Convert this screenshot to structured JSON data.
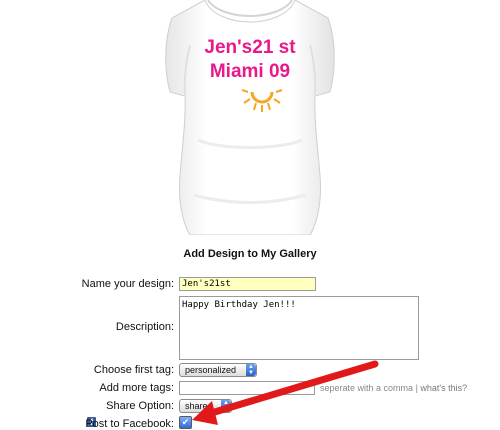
{
  "shirt": {
    "print_line1": "Jen's21 st",
    "print_line2": "Miami 09"
  },
  "form": {
    "title": "Add Design to My Gallery",
    "name_label": "Name your design:",
    "name_value": "Jen's21st",
    "description_label": "Description:",
    "description_value": "Happy Birthday Jen!!!",
    "first_tag_label": "Choose first tag:",
    "first_tag_value": "personalized",
    "more_tags_label": "Add more tags:",
    "more_tags_value": "",
    "more_tags_hint": "seperate with a comma",
    "more_tags_link": "what's this?",
    "share_label": "Share Option:",
    "share_value": "share",
    "facebook_label": "Post to Facebook:",
    "facebook_checked": true
  },
  "colors": {
    "print_pink": "#e8198b",
    "sun_orange": "#f5a623",
    "highlight_yellow": "#ffffc0",
    "arrow_red": "#e01a1a",
    "facebook_blue": "#3b5998"
  }
}
